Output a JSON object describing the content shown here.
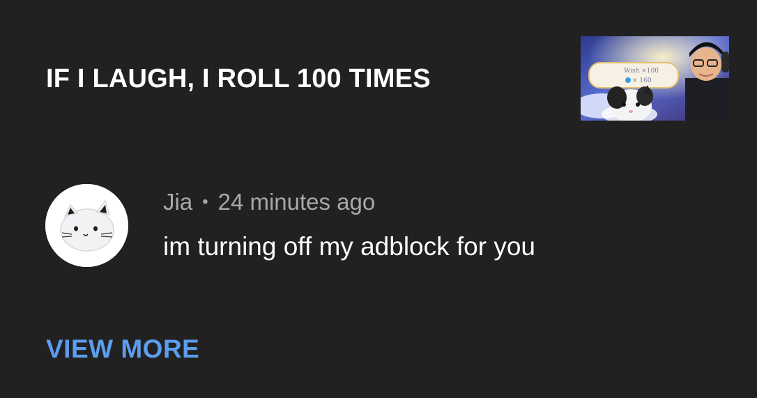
{
  "video": {
    "title": "IF I LAUGH, I ROLL 100 TIMES",
    "thumbnail": {
      "banner_text": "Wish ×100",
      "banner_count": "× 160"
    }
  },
  "comment": {
    "author": "Jia",
    "separator": "•",
    "timestamp": "24 minutes ago",
    "text": "im turning off my adblock for you",
    "avatar_icon": "white-cat-avatar-icon"
  },
  "actions": {
    "view_more_label": "VIEW MORE"
  },
  "colors": {
    "background": "#212121",
    "title": "#ffffff",
    "meta": "#a8a8a8",
    "link": "#5c9ded"
  }
}
